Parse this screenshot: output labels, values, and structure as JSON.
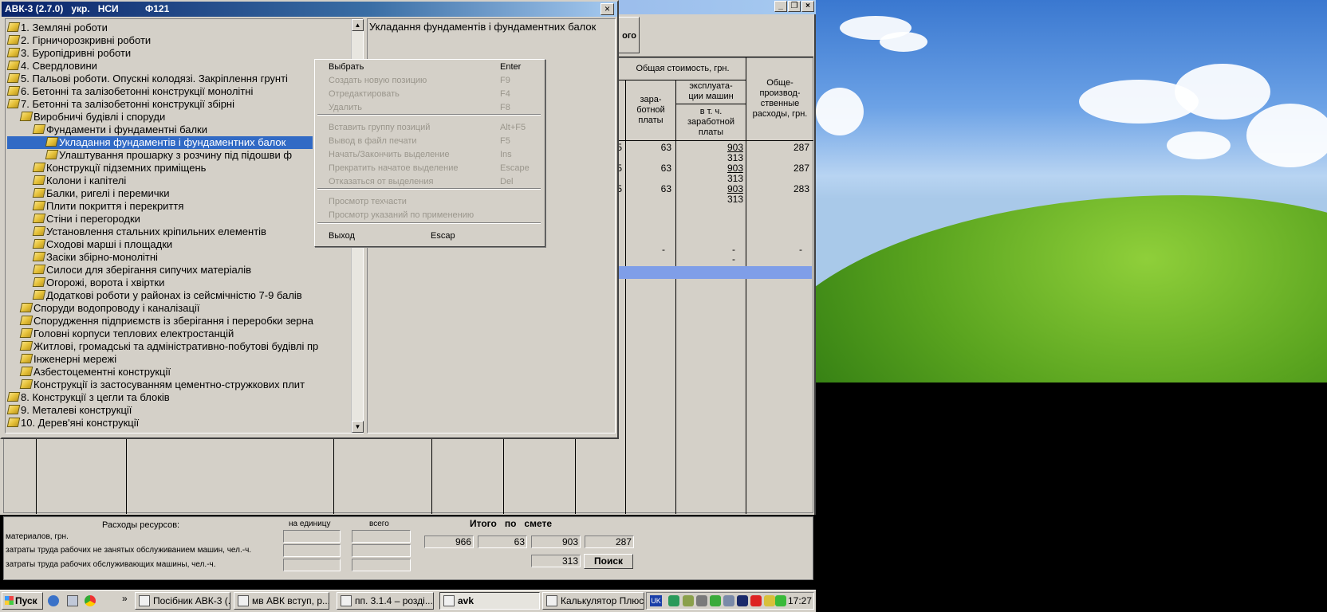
{
  "background_window": {
    "top_button_label": "ого",
    "headers": {
      "total_cost": "Общая стоимость, грн.",
      "wages": "зара-\nботной\nплаты",
      "machine_operation": "эксплуата-\nции машин",
      "incl_wages": "в т. ч.\nзаработной\nплаты",
      "overhead": "Обще-\nпроизвод-\nственные\nрасходы, грн."
    },
    "rows": [
      {
        "wages": "63",
        "machines": "903",
        "machine_wages": "313",
        "overhead": "287"
      },
      {
        "wages": "63",
        "machines": "903",
        "machine_wages": "313",
        "overhead": "287"
      },
      {
        "wages": "63",
        "machines": "903",
        "machine_wages": "313",
        "overhead": "283"
      }
    ],
    "row_prefix": "5",
    "empty_marks": [
      "-",
      "-",
      "-",
      "-"
    ]
  },
  "bottom_panel": {
    "resources_title": "Расходы ресурсов:",
    "per_unit_label": "на единицу",
    "total_label": "всего",
    "itogo_label": "Итого   по   смете",
    "rows": [
      "материалов, грн.",
      "затраты труда рабочих не занятых обслуживанием машин, чел.-ч.",
      "затраты труда рабочих обслуживающих машины, чел.-ч."
    ],
    "totals": [
      "966",
      "63",
      "903",
      "287"
    ],
    "machine_labor_total": "313",
    "search_button": "Поиск"
  },
  "front_window": {
    "title": "АВК-3 (2.7.0)   укр.   НСИ          Ф121",
    "close_glyph": "×",
    "description": "Укладання фундаментів і фундаментних балок",
    "tree": [
      {
        "label": "1. Земляні роботи",
        "level": 0
      },
      {
        "label": "2. Гірничорозкривні роботи",
        "level": 0
      },
      {
        "label": "3. Буропідривні роботи",
        "level": 0
      },
      {
        "label": "4. Свердловини",
        "level": 0
      },
      {
        "label": "5. Пальові роботи. Опускні колодязі. Закріплення грунті",
        "level": 0
      },
      {
        "label": "6. Бетонні та залізобетонні конструкції монолітні",
        "level": 0
      },
      {
        "label": "7. Бетонні та залізобетонні конструкції збірні",
        "level": 0
      },
      {
        "label": "Виробничі будівлі і споруди",
        "level": 1
      },
      {
        "label": "Фундаменти і фундаментні балки",
        "level": 2
      },
      {
        "label": "Укладання фундаментів і фундаментних балок",
        "level": 3,
        "selected": true
      },
      {
        "label": "Улаштування прошарку з розчину під підошви ф",
        "level": 3
      },
      {
        "label": "Конструкції підземних приміщень",
        "level": 2
      },
      {
        "label": "Колони і капітелі",
        "level": 2
      },
      {
        "label": "Балки, ригелі і перемички",
        "level": 2
      },
      {
        "label": "Плити покриття і перекриття",
        "level": 2
      },
      {
        "label": "Стіни і перегородки",
        "level": 2
      },
      {
        "label": "Установлення стальних кріпильних елементів",
        "level": 2
      },
      {
        "label": "Сходові марші і площадки",
        "level": 2
      },
      {
        "label": "Засіки збірно-монолітні",
        "level": 2
      },
      {
        "label": "Силоси для зберігання сипучих матеріалів",
        "level": 2
      },
      {
        "label": "Огорожі, ворота і хвіртки",
        "level": 2
      },
      {
        "label": "Додаткові роботи у районах із сейсмічністю 7-9 балів",
        "level": 2
      },
      {
        "label": "Споруди водопроводу і каналізації",
        "level": 1
      },
      {
        "label": "Спорудження підприємств із зберігання і переробки зерна",
        "level": 1
      },
      {
        "label": "Головні корпуси теплових електростанцій",
        "level": 1
      },
      {
        "label": "Житлові, громадські та адміністративно-побутові будівлі пр",
        "level": 1
      },
      {
        "label": "Інженерні мережі",
        "level": 1
      },
      {
        "label": "Азбестоцементні конструкції",
        "level": 1
      },
      {
        "label": "Конструкції із застосуванням цементно-стружкових плит",
        "level": 1
      },
      {
        "label": "8. Конструкції з цегли та блоків",
        "level": 0
      },
      {
        "label": "9. Металеві конструкції",
        "level": 0
      },
      {
        "label": "10. Дерев'яні конструкції",
        "level": 0
      }
    ]
  },
  "context_menu": {
    "items": [
      {
        "label": "Выбрать",
        "key": "Enter",
        "disabled": false
      },
      {
        "label": "Создать новую позицию",
        "key": "F9",
        "disabled": true
      },
      {
        "label": "Отредактировать",
        "key": "F4",
        "disabled": true
      },
      {
        "label": "Удалить",
        "key": "F8",
        "disabled": true
      },
      {
        "label": "Вставить группу позиций",
        "key": "Alt+F5",
        "disabled": true
      },
      {
        "label": "Вывод в файл печати",
        "key": "F5",
        "disabled": true
      },
      {
        "label": "Начать/Закончить выделение",
        "key": "Ins",
        "disabled": true
      },
      {
        "label": "Прекратить начатое выделение",
        "key": "Escape",
        "disabled": true
      },
      {
        "label": "Отказаться от выделения",
        "key": "Del",
        "disabled": true
      },
      {
        "label": "Просмотр техчасти",
        "key": "",
        "disabled": true
      },
      {
        "label": "Просмотр указаний по применению",
        "key": "",
        "disabled": true
      },
      {
        "label": "Выход",
        "key": "Escap",
        "disabled": false
      }
    ]
  },
  "taskbar": {
    "start_label": "Пуск",
    "chevron": "»",
    "tasks": [
      {
        "label": "Посібник АВК-3 (...",
        "active": false
      },
      {
        "label": "мв АВК вступ, р...",
        "active": false
      },
      {
        "label": "пп. 3.1.4 – розді...",
        "active": false
      },
      {
        "label": "avk",
        "active": true
      },
      {
        "label": "Калькулятор Плюс",
        "active": false
      }
    ],
    "lang": "UK",
    "clock": "17:27"
  }
}
